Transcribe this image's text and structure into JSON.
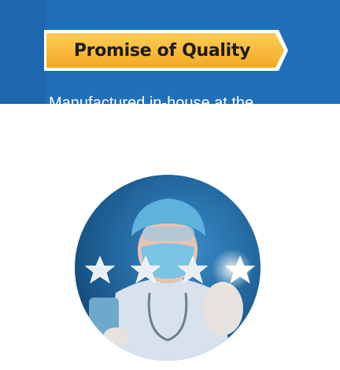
{
  "banner": {
    "title": "Promise of Quality",
    "intro": "Manufactured in-house at the"
  },
  "photo": {
    "subject": "doctor-rating-stars",
    "rating_stars": 4
  },
  "colors": {
    "panel_blue": "#1f70b9",
    "ribbon_gold": "#f6b22e",
    "ribbon_gold_light": "#fbc44a",
    "title_text": "#1b1b1b",
    "intro_text": "#ffffff"
  }
}
